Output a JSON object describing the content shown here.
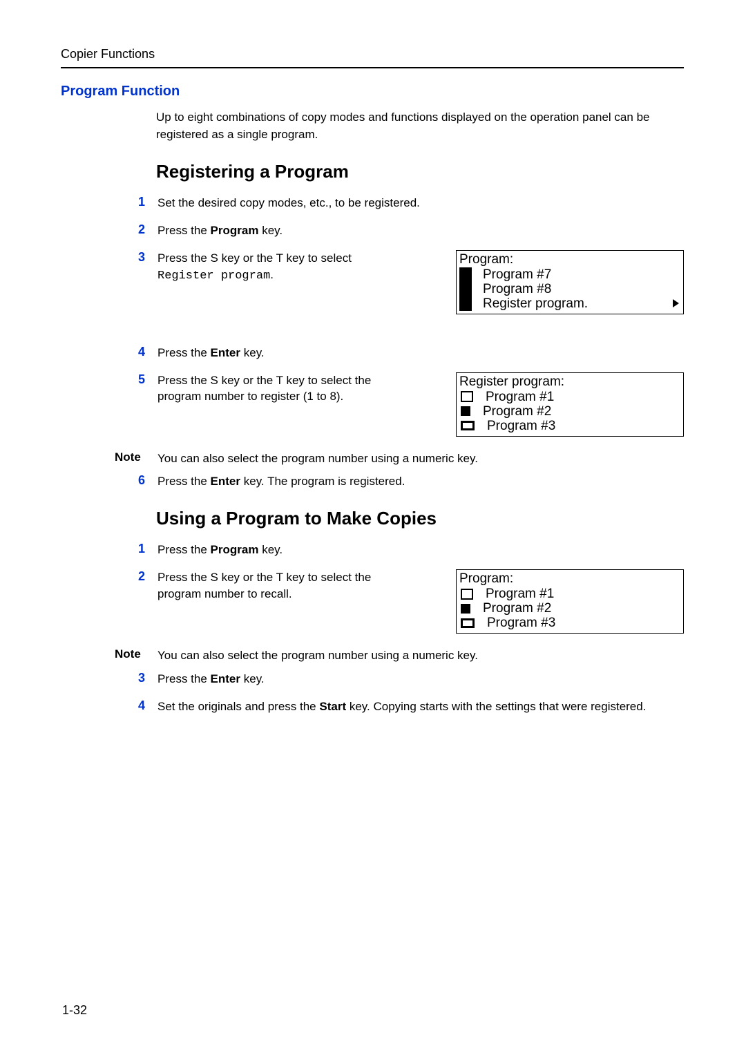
{
  "header": {
    "running": "Copier Functions"
  },
  "section_title": "Program Function",
  "intro": "Up to eight combinations of copy modes and functions displayed on the operation panel can be registered as a single program.",
  "h_register": "Registering a Program",
  "reg_steps": {
    "s1": "Set the desired copy modes, etc., to be registered.",
    "s2a": "Press the ",
    "s2b": "Program",
    "s2c": " key.",
    "s3a": "Press the  S key or the  T key to select ",
    "s3b": "Register program",
    "s3c": ".",
    "s4a": "Press the ",
    "s4b": "Enter",
    "s4c": " key.",
    "s5": "Press the  S key or the  T key to select the program number to register (1 to 8).",
    "s6a": "Press the ",
    "s6b": "Enter",
    "s6c": " key. The program is registered."
  },
  "note_label": "Note",
  "note1": "You can also select the program number using a numeric key.",
  "h_use": "Using a Program to Make Copies",
  "use_steps": {
    "s1a": "Press the ",
    "s1b": "Program",
    "s1c": " key.",
    "s2": "Press the  S key or the  T key to select the program number to recall.",
    "s3a": "Press the ",
    "s3b": "Enter",
    "s3c": " key.",
    "s4a": "Set the originals and press the ",
    "s4b": "Start",
    "s4c": " key. Copying starts with the settings that were registered."
  },
  "note2": "You can also select the program number using a numeric key.",
  "lcd1": {
    "title": "Program:",
    "r1": "Program #7",
    "r2": "Program #8",
    "r3": "Register program."
  },
  "lcd2": {
    "title": "Register program:",
    "r1": "Program #1",
    "r2": "Program #2",
    "r3": "Program #3"
  },
  "lcd3": {
    "title": "Program:",
    "r1": "Program #1",
    "r2": "Program #2",
    "r3": "Program #3"
  },
  "nums": {
    "n1": "1",
    "n2": "2",
    "n3": "3",
    "n4": "4",
    "n5": "5",
    "n6": "6"
  },
  "page_number": "1-32"
}
